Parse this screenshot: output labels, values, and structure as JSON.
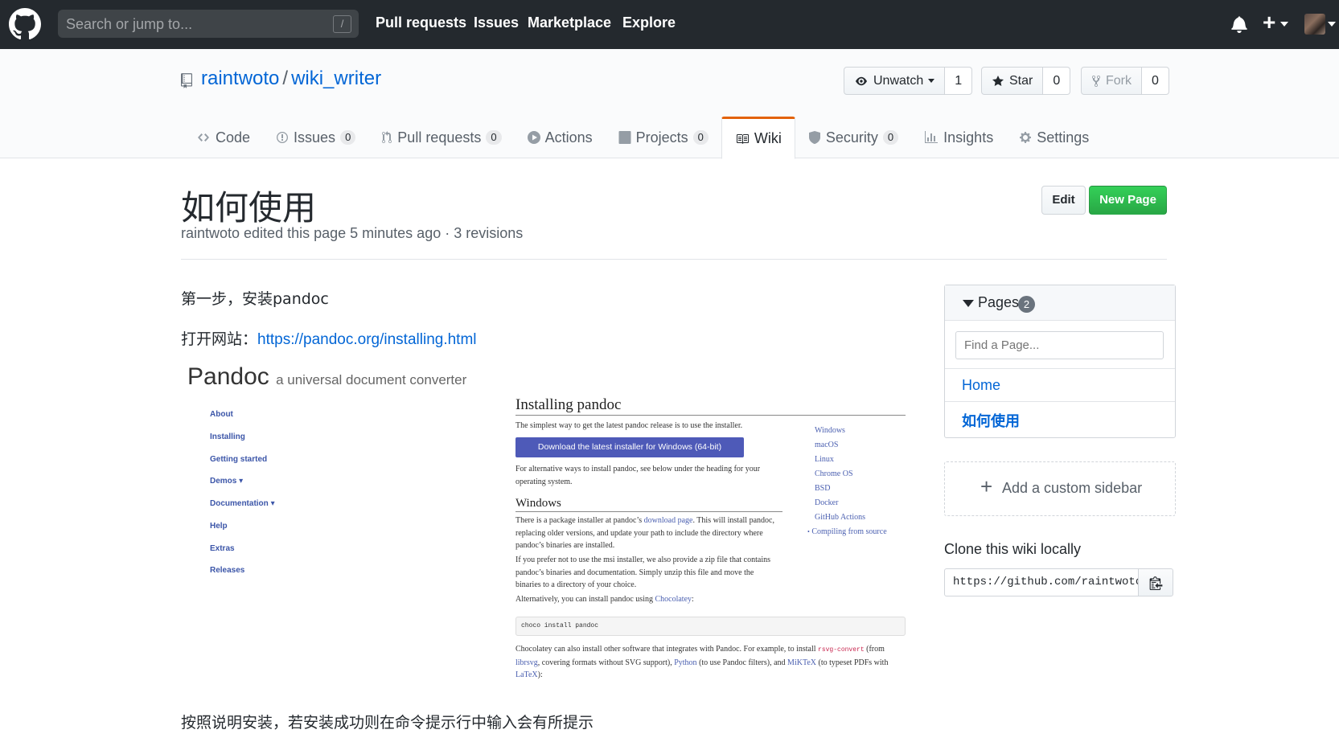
{
  "header": {
    "search_placeholder": "Search or jump to...",
    "search_shortcut": "/",
    "nav": [
      "Pull requests",
      "Issues",
      "Marketplace",
      "Explore"
    ],
    "new_label": "+"
  },
  "repo": {
    "owner": "raintwoto",
    "separator": "/",
    "name": "wiki_writer",
    "unwatch_label": "Unwatch",
    "watch_count": "1",
    "star_label": "Star",
    "star_count": "0",
    "fork_label": "Fork",
    "fork_count": "0"
  },
  "tabs": [
    {
      "label": "Code"
    },
    {
      "label": "Issues",
      "count": "0"
    },
    {
      "label": "Pull requests",
      "count": "0"
    },
    {
      "label": "Actions"
    },
    {
      "label": "Projects",
      "count": "0"
    },
    {
      "label": "Wiki",
      "selected": true
    },
    {
      "label": "Security",
      "count": "0"
    },
    {
      "label": "Insights"
    },
    {
      "label": "Settings"
    }
  ],
  "wiki": {
    "title": "如何使用",
    "meta": "raintwoto edited this page 5 minutes ago · 3 revisions",
    "edit_label": "Edit",
    "new_page_label": "New Page",
    "step1": "第一步，安装pandoc",
    "open_site_prefix": "打开网站：",
    "open_site_link": "https://pandoc.org/installing.html",
    "final_para": "按照说明安装，若安装成功则在命令提示行中输入会有所提示"
  },
  "embedded_screenshot": {
    "brand": "Pandoc",
    "tagline": "a universal document converter",
    "side_nav": [
      "About",
      "Installing",
      "Getting started",
      "Demos",
      "Documentation",
      "Help",
      "Extras",
      "Releases"
    ],
    "dropdown_mark": "▾",
    "heading": "Installing pandoc",
    "intro": "The simplest way to get the latest pandoc release is to use the installer.",
    "download_button": "Download the latest installer for Windows (64-bit)",
    "alt_text": "For alternative ways to install pandoc, see below under the heading for your operating system.",
    "toc": [
      "Windows",
      "macOS",
      "Linux",
      "Chrome OS",
      "BSD",
      "Docker",
      "GitHub Actions",
      "Compiling from source"
    ],
    "toc_bullet": "•",
    "windows_heading": "Windows",
    "win_p1_a": "There is a package installer at pandoc’s ",
    "win_p1_link": "download page",
    "win_p1_b": ". This will install pandoc, replacing older versions, and update your path to include the directory where pandoc’s binaries are installed.",
    "win_p2": "If you prefer not to use the msi installer, we also provide a zip file that contains pandoc’s binaries and documentation. Simply unzip this file and move the binaries to a directory of your choice.",
    "win_p3_a": "Alternatively, you can install pandoc using ",
    "win_p3_link": "Chocolatey",
    "win_p3_b": ":",
    "code": "choco install pandoc",
    "win_p4_a": "Chocolatey can also install other software that integrates with Pandoc. For example, to install ",
    "win_p4_code": "rsvg-convert",
    "win_p4_b": " (from ",
    "win_p4_link1": "librsvg",
    "win_p4_c": ", covering formats without SVG support), ",
    "win_p4_link2": "Python",
    "win_p4_d": " (to use Pandoc filters), and ",
    "win_p4_link3": "MiKTeX",
    "win_p4_e": " (to typeset PDFs with ",
    "win_p4_link4": "LaTeX",
    "win_p4_f": "):"
  },
  "sidebar": {
    "pages_label": "Pages",
    "pages_count": "2",
    "filter_placeholder": "Find a Page...",
    "pages": [
      "Home",
      "如何使用"
    ],
    "custom_sidebar_plus": "+",
    "custom_sidebar_label": "Add a custom sidebar",
    "clone_title": "Clone this wiki locally",
    "clone_url": "https://github.com/raintwoto/wiki_writer.wiki.git"
  }
}
